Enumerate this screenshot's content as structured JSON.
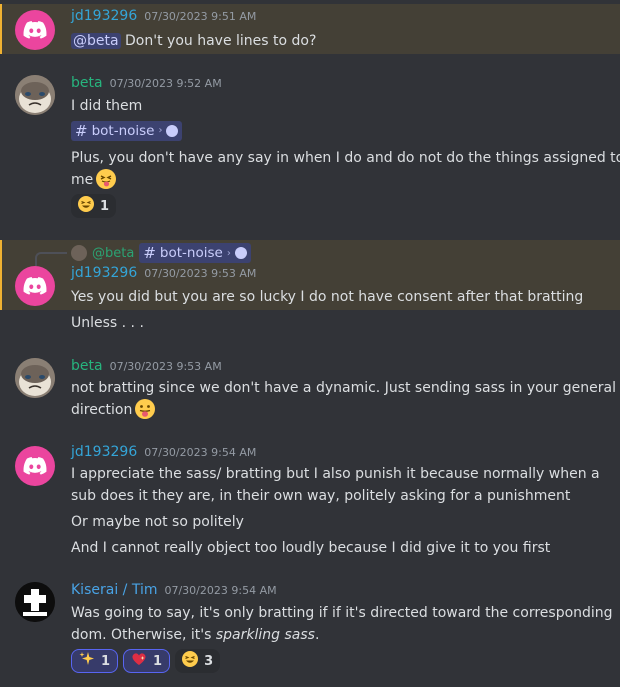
{
  "messages": {
    "m1": {
      "username": "jd193296",
      "timestamp": "07/30/2023 9:51 AM",
      "mention": "@beta",
      "text": "Don't you have lines to do?"
    },
    "m2": {
      "username": "beta",
      "timestamp": "07/30/2023 9:52 AM",
      "line1": "I did them",
      "channel_chip": "bot-noise",
      "line3": "Plus, you don't have any say in when I do and do not do the things assigned to",
      "line4": "me",
      "reaction": {
        "emoji": "laughing-emoji",
        "count": "1"
      }
    },
    "m3": {
      "reply_to_user": "@beta",
      "reply_chip": "bot-noise",
      "username": "jd193296",
      "timestamp": "07/30/2023 9:53 AM",
      "text": "Yes you did but you are so lucky I do not have consent after that bratting",
      "followup": "Unless . . ."
    },
    "m4": {
      "username": "beta",
      "timestamp": "07/30/2023 9:53 AM",
      "line1": "not bratting since we don't have a dynamic. Just sending sass in your general",
      "line2": "direction"
    },
    "m5": {
      "username": "jd193296",
      "timestamp": "07/30/2023 9:54 AM",
      "line1": "I appreciate the sass/ bratting but I also punish it because normally when a",
      "line2": "sub does it they are, in their own way, politely asking for a punishment",
      "line3": "Or maybe not so politely",
      "line4": "And I cannot really object too loudly because I did give it to you first"
    },
    "m6": {
      "username": "Kiserai / Tim",
      "timestamp": "07/30/2023 9:54 AM",
      "line1": "Was going to say, it's only bratting if if it's directed toward the corresponding",
      "line2_prefix": "dom. Otherwise, it's ",
      "line2_italic": "sparkling sass",
      "line2_suffix": ".",
      "reactions": [
        {
          "emoji": "sparkles-emoji",
          "count": "1"
        },
        {
          "emoji": "sparkling-heart-emoji",
          "count": "1"
        },
        {
          "emoji": "laughing-emoji",
          "count": "3"
        }
      ]
    }
  },
  "colors": {
    "background": "#313338",
    "mention_highlight": "#444036",
    "mention_bar": "#f0b232",
    "discord_avatar": "#eb459e",
    "username_jd": "#34a5d8",
    "username_beta": "#27b47e",
    "username_kiserai": "#49a3e5"
  }
}
